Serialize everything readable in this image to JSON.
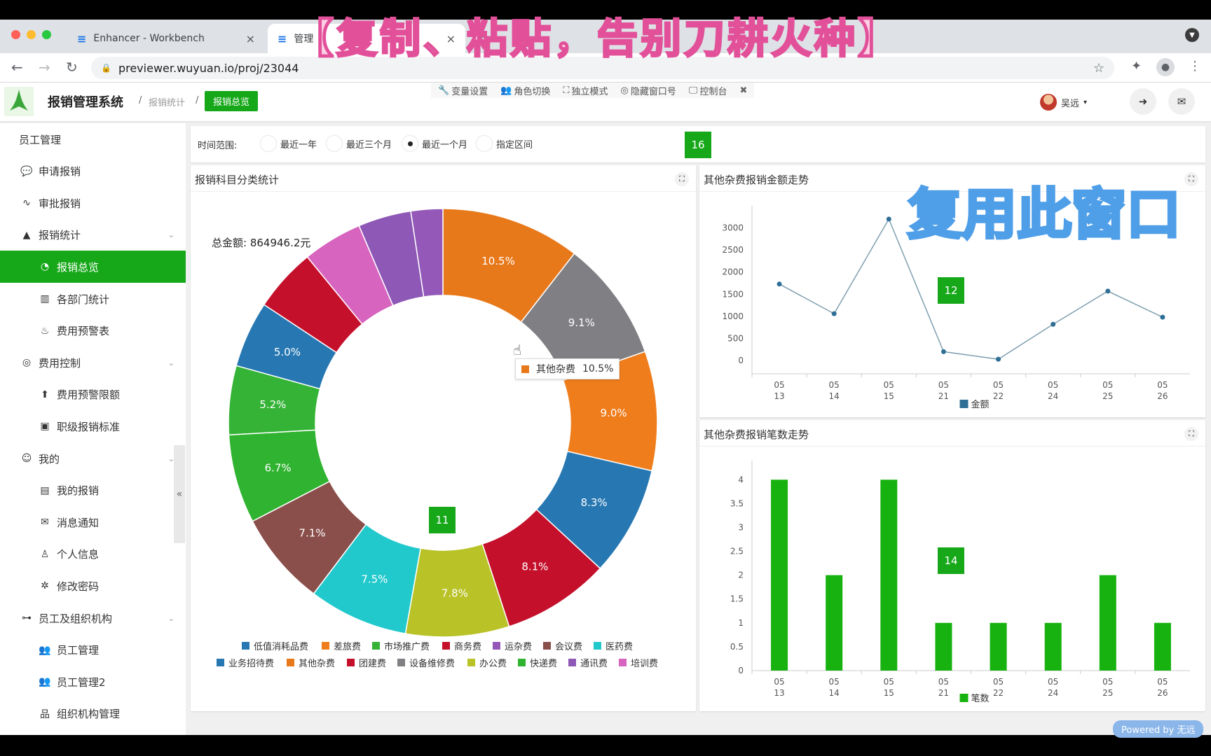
{
  "browser": {
    "tabs": [
      {
        "label": "Enhancer - Workbench",
        "active": false
      },
      {
        "label": "管理",
        "active": true
      }
    ],
    "url": "previewer.wuyuan.io/proj/23044"
  },
  "overlay": {
    "title": "【复制、粘贴，告别刀耕火种】",
    "reuse_label": "复用此窗口"
  },
  "header": {
    "app_title": "报销管理系统",
    "breadcrumb": [
      "报销统计",
      "报销总览"
    ],
    "breadcrumb_sep": "/",
    "toolbar": [
      {
        "icon": "wrench-icon",
        "glyph": "🔧",
        "label": "变量设置"
      },
      {
        "icon": "users-icon",
        "glyph": "👥",
        "label": "角色切换"
      },
      {
        "icon": "expand-icon",
        "glyph": "⛶",
        "label": "独立模式"
      },
      {
        "icon": "eye-slash-icon",
        "glyph": "◎",
        "label": "隐藏窗口号"
      },
      {
        "icon": "monitor-icon",
        "glyph": "🖵",
        "label": "控制台"
      }
    ],
    "toolbar_close": "✖",
    "user_name": "吴远",
    "logout_glyph": "➜",
    "mail_glyph": "✉"
  },
  "sidebar": {
    "items": [
      {
        "label": "员工管理",
        "icon": "",
        "level": 1
      },
      {
        "label": "申请报销",
        "icon": "💬",
        "level": 1
      },
      {
        "label": "审批报销",
        "icon": "∿",
        "level": 1
      },
      {
        "label": "报销统计",
        "icon": "▲",
        "level": 1,
        "chevron": "⌄"
      },
      {
        "label": "报销总览",
        "icon": "◔",
        "level": 2,
        "active": true
      },
      {
        "label": "各部门统计",
        "icon": "▥",
        "level": 2
      },
      {
        "label": "费用预警表",
        "icon": "♨",
        "level": 2
      },
      {
        "label": "费用控制",
        "icon": "◎",
        "level": 1,
        "chevron": "⌄"
      },
      {
        "label": "费用预警限额",
        "icon": "⬆",
        "level": 2
      },
      {
        "label": "职级报销标准",
        "icon": "▣",
        "level": 2
      },
      {
        "label": "我的",
        "icon": "☺",
        "level": 1,
        "chevron": "⌄"
      },
      {
        "label": "我的报销",
        "icon": "▤",
        "level": 2
      },
      {
        "label": "消息通知",
        "icon": "✉",
        "level": 2
      },
      {
        "label": "个人信息",
        "icon": "♙",
        "level": 2
      },
      {
        "label": "修改密码",
        "icon": "✲",
        "level": 2
      },
      {
        "label": "员工及组织机构",
        "icon": "⊶",
        "level": 1,
        "chevron": "⌄"
      },
      {
        "label": "员工管理",
        "icon": "👥",
        "level": 2
      },
      {
        "label": "员工管理2",
        "icon": "👥",
        "level": 2
      },
      {
        "label": "组织机构管理",
        "icon": "品",
        "level": 2
      }
    ],
    "collapse_glyph": "«"
  },
  "filter": {
    "label": "时间范围:",
    "options": [
      "最近一年",
      "最近三个月",
      "最近一个月",
      "指定区间"
    ],
    "selected": "最近一个月",
    "badge": "16"
  },
  "panels": {
    "donut": {
      "title": "报销科目分类统计",
      "total": "总金额: 864946.2元",
      "badge": "11"
    },
    "line": {
      "title": "其他杂费报销金额走势",
      "badge": "12"
    },
    "bar": {
      "title": "其他杂费报销笔数走势",
      "badge": "14"
    },
    "expand_glyph": "⛶"
  },
  "tooltip": {
    "name": "其他杂费",
    "value": "10.5%",
    "color": "#e8791b"
  },
  "powered_by": "Powered by 无远",
  "chart_data": [
    {
      "type": "pie",
      "title": "报销科目分类统计",
      "subtitle": "总金额: 864946.2元",
      "donut": true,
      "slices": [
        {
          "name": "其他杂费",
          "value": 10.5,
          "color": "#e8791b",
          "label": "10.5%"
        },
        {
          "name": "设备维修费",
          "value": 9.1,
          "color": "#807f83",
          "label": "9.1%"
        },
        {
          "name": "差旅费",
          "value": 9.0,
          "color": "#ef7d1c",
          "label": "9.0%"
        },
        {
          "name": "业务招待费",
          "value": 8.3,
          "color": "#2778b2",
          "label": "8.3%"
        },
        {
          "name": "团建费",
          "value": 8.1,
          "color": "#c5102c",
          "label": "8.1%"
        },
        {
          "name": "办公费",
          "value": 7.8,
          "color": "#b9c226",
          "label": "7.8%"
        },
        {
          "name": "医药费",
          "value": 7.5,
          "color": "#22c9cc",
          "label": "7.5%"
        },
        {
          "name": "会议费",
          "value": 7.1,
          "color": "#8a4f4b",
          "label": "7.1%"
        },
        {
          "name": "快递费",
          "value": 6.7,
          "color": "#2fb330",
          "label": "6.7%"
        },
        {
          "name": "市场推广费",
          "value": 5.2,
          "color": "#34b336",
          "label": "5.2%"
        },
        {
          "name": "低值消耗品费",
          "value": 5.0,
          "color": "#2778b2",
          "label": "5.0%"
        },
        {
          "name": "商务费",
          "value": 4.8,
          "color": "#c5102c",
          "label": ""
        },
        {
          "name": "培训费",
          "value": 4.5,
          "color": "#d764bf",
          "label": ""
        },
        {
          "name": "通讯费",
          "value": 4.0,
          "color": "#8e58b7",
          "label": ""
        },
        {
          "name": "运杂费",
          "value": 2.4,
          "color": "#9358b8",
          "label": ""
        }
      ],
      "legend": [
        {
          "name": "低值消耗品费",
          "color": "#2778b2"
        },
        {
          "name": "差旅费",
          "color": "#ef7d1c"
        },
        {
          "name": "市场推广费",
          "color": "#34b336"
        },
        {
          "name": "商务费",
          "color": "#c5102c"
        },
        {
          "name": "运杂费",
          "color": "#9358b8"
        },
        {
          "name": "会议费",
          "color": "#8a4f4b"
        },
        {
          "name": "医药费",
          "color": "#22c9cc"
        },
        {
          "name": "业务招待费",
          "color": "#2778b2"
        },
        {
          "name": "其他杂费",
          "color": "#e8791b"
        },
        {
          "name": "团建费",
          "color": "#c5102c"
        },
        {
          "name": "设备维修费",
          "color": "#807f83"
        },
        {
          "name": "办公费",
          "color": "#b9c226"
        },
        {
          "name": "快递费",
          "color": "#2fb330"
        },
        {
          "name": "通讯费",
          "color": "#8e58b7"
        },
        {
          "name": "培训费",
          "color": "#d764bf"
        }
      ],
      "legend_position": "bottom"
    },
    {
      "type": "line",
      "title": "其他杂费报销金额走势",
      "categories": [
        "05\n13",
        "05\n14",
        "05\n15",
        "05\n21",
        "05\n22",
        "05\n24",
        "05\n25",
        "05\n26"
      ],
      "series": [
        {
          "name": "金额",
          "values": [
            1730,
            1060,
            3200,
            200,
            30,
            820,
            1570,
            980
          ],
          "color": "#2f6f96"
        }
      ],
      "yticks": [
        0,
        500,
        1000,
        1500,
        2000,
        2500,
        3000
      ],
      "ylim": [
        -300,
        3500
      ],
      "legend_position": "bottom"
    },
    {
      "type": "bar",
      "title": "其他杂费报销笔数走势",
      "categories": [
        "05\n13",
        "05\n14",
        "05\n15",
        "05\n21",
        "05\n22",
        "05\n24",
        "05\n25",
        "05\n26"
      ],
      "series": [
        {
          "name": "笔数",
          "values": [
            4,
            2,
            4,
            1,
            1,
            1,
            2,
            1
          ],
          "color": "#17b20f"
        }
      ],
      "yticks": [
        0,
        0.5,
        1,
        1.5,
        2,
        2.5,
        3,
        3.5,
        4
      ],
      "ylim": [
        0,
        4.4
      ],
      "legend_position": "bottom"
    }
  ]
}
